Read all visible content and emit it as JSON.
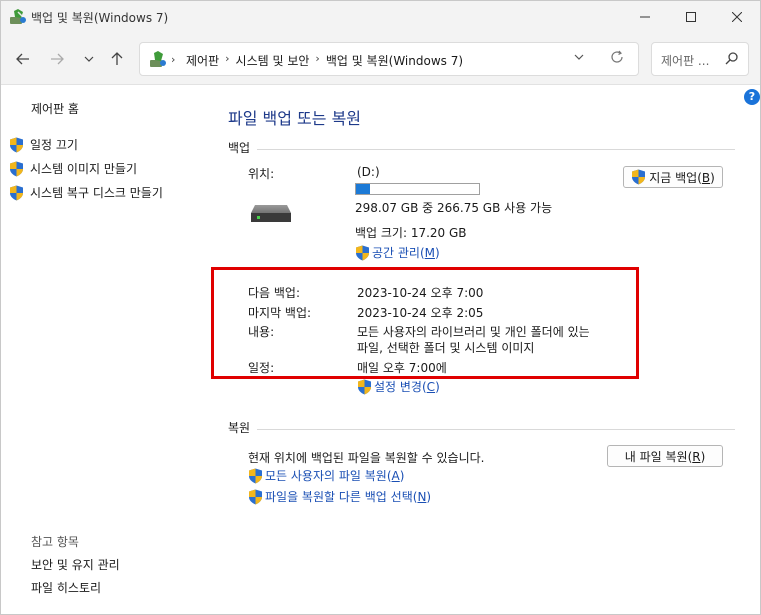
{
  "window": {
    "title": "백업 및 복원(Windows 7)"
  },
  "address": {
    "crumbs": [
      "제어판",
      "시스템 및 보안",
      "백업 및 복원(Windows 7)"
    ],
    "search_placeholder": "제어판 ..."
  },
  "help": "?",
  "left": {
    "home": "제어판 홈",
    "tasks": [
      "일정 끄기",
      "시스템 이미지 만들기",
      "시스템 복구 디스크 만들기"
    ],
    "see_also_title": "참고 항목",
    "see_also": [
      "보안 및 유지 관리",
      "파일 히스토리"
    ]
  },
  "main": {
    "title": "파일 백업 또는 복원",
    "backup": {
      "section": "백업",
      "location_label": "위치:",
      "location_value": "(D:)",
      "usage_fraction": 0.11,
      "usage_text": "298.07 GB 중 266.75 GB 사용 가능",
      "size_text": "백업 크기: 17.20 GB",
      "manage_space": "공간 관리",
      "manage_space_key": "M",
      "backup_now": "지금 백업",
      "backup_now_key": "B",
      "next_label": "다음 백업:",
      "next_value": "2023-10-24 오후 7:00",
      "last_label": "마지막 백업:",
      "last_value": "2023-10-24 오후 2:05",
      "contents_label": "내용:",
      "contents_line1": "모든 사용자의 라이브러리 및 개인 폴더에 있는",
      "contents_line2": "파일, 선택한 폴더 및 시스템 이미지",
      "schedule_label": "일정:",
      "schedule_value": "매일 오후 7:00에",
      "change_settings": "설정 변경",
      "change_settings_key": "C"
    },
    "restore": {
      "section": "복원",
      "description": "현재 위치에 백업된 파일을 복원할 수 있습니다.",
      "restore_my_files": "내 파일 복원",
      "restore_my_files_key": "R",
      "restore_all_users": "모든 사용자의 파일 복원",
      "restore_all_users_key": "A",
      "select_other_backup": "파일을 복원할 다른 백업 선택",
      "select_other_backup_key": "N"
    }
  }
}
